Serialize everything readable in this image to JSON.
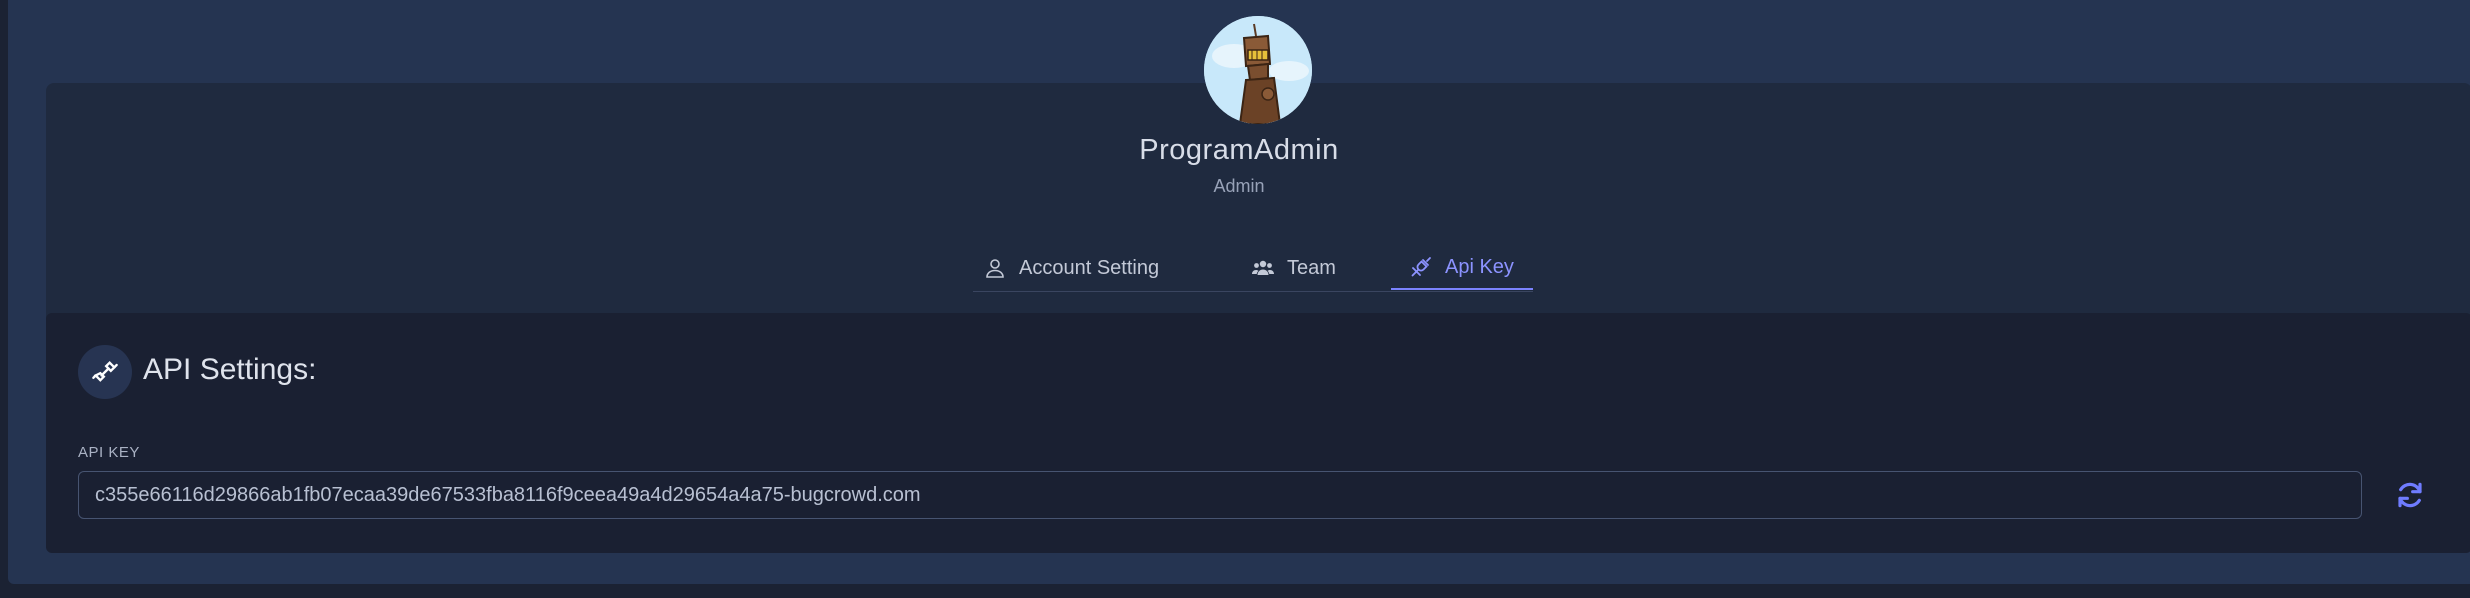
{
  "profile": {
    "name": "ProgramAdmin",
    "role": "Admin"
  },
  "tabs": [
    {
      "label": "Account Setting",
      "icon": "user-icon",
      "active": false
    },
    {
      "label": "Team",
      "icon": "users-icon",
      "active": false
    },
    {
      "label": "Api Key",
      "icon": "plug-icon",
      "active": true
    }
  ],
  "api": {
    "title": "API Settings:",
    "key_label": "API KEY",
    "key_value": "c355e66116d29866ab1fb07ecaa39de67533fba8116f9ceea49a4d29654a4a75-bugcrowd.com"
  },
  "icons": {
    "api_header": "plug-icon",
    "refresh": "refresh-icon"
  },
  "colors": {
    "accent": "#7b83ff",
    "background": "#253451",
    "card": "#1f2a3f",
    "api_card": "#1a2032"
  }
}
